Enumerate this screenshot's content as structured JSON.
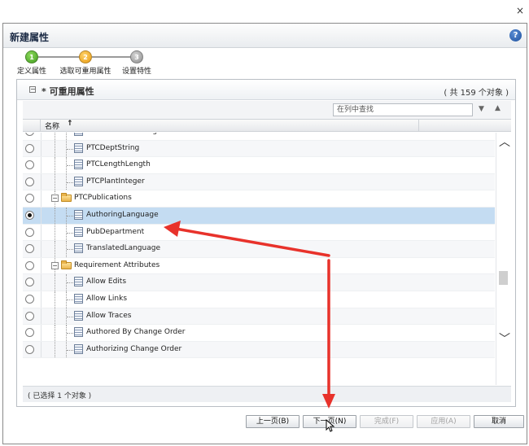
{
  "window": {
    "close_glyph": "×"
  },
  "dialog": {
    "title": "新建属性",
    "help_glyph": "?"
  },
  "steps": [
    {
      "number": "1",
      "label": "定义属性",
      "state": "done",
      "color": "#4caf2a"
    },
    {
      "number": "2",
      "label": "选取可重用属性",
      "state": "current",
      "color": "#f2a81d"
    },
    {
      "number": "3",
      "label": "设置特性",
      "state": "pending",
      "color": "#9e9e9e"
    }
  ],
  "panel": {
    "collapse_glyph": "−",
    "title": "* 可重用属性",
    "count": "( 共 159 个对象 )",
    "find_placeholder": "在列中查找",
    "column_name": "名称",
    "sort_glyph": "↑",
    "status": "( 已选择 1 个对象 )"
  },
  "rows": [
    {
      "type": "attr",
      "label": "PTCComCodeString",
      "level": 2,
      "checked": false
    },
    {
      "type": "attr",
      "label": "PTCDeptString",
      "level": 2,
      "checked": false
    },
    {
      "type": "attr",
      "label": "PTCLengthLength",
      "level": 2,
      "checked": false
    },
    {
      "type": "attr",
      "label": "PTCPlantInteger",
      "level": 2,
      "checked": false
    },
    {
      "type": "folder",
      "label": "PTCPublications",
      "level": 1,
      "checked": false
    },
    {
      "type": "attr",
      "label": "AuthoringLanguage",
      "level": 2,
      "checked": true
    },
    {
      "type": "attr",
      "label": "PubDepartment",
      "level": 2,
      "checked": false
    },
    {
      "type": "attr",
      "label": "TranslatedLanguage",
      "level": 2,
      "checked": false
    },
    {
      "type": "folder",
      "label": "Requirement Attributes",
      "level": 1,
      "checked": false
    },
    {
      "type": "attr",
      "label": "Allow Edits",
      "level": 2,
      "checked": false
    },
    {
      "type": "attr",
      "label": "Allow Links",
      "level": 2,
      "checked": false
    },
    {
      "type": "attr",
      "label": "Allow Traces",
      "level": 2,
      "checked": false
    },
    {
      "type": "attr",
      "label": "Authored By Change Order",
      "level": 2,
      "checked": false
    },
    {
      "type": "attr",
      "label": "Authorizing Change Order",
      "level": 2,
      "checked": false
    }
  ],
  "buttons": {
    "back": "上一页(B)",
    "next": "下一页(N)",
    "finish": "完成(F)",
    "apply": "应用(A)",
    "cancel": "取消"
  },
  "colors": {
    "selected_row": "#c4dcf2",
    "annotation_arrow": "#e8322b"
  }
}
